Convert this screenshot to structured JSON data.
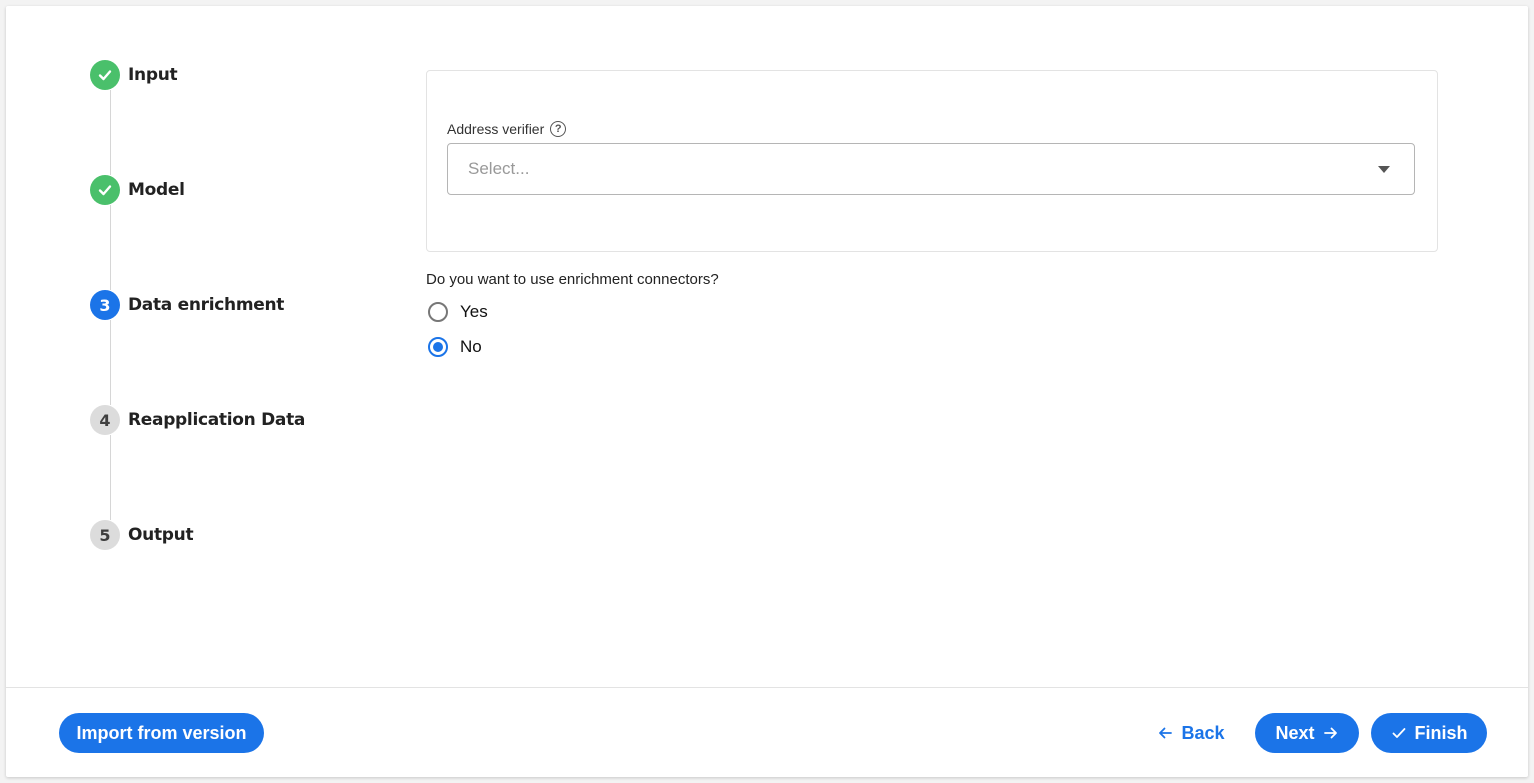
{
  "stepper": {
    "steps": [
      {
        "label": "Input",
        "status": "done",
        "number": "1"
      },
      {
        "label": "Model",
        "status": "done",
        "number": "2"
      },
      {
        "label": "Data enrichment",
        "status": "active",
        "number": "3"
      },
      {
        "label": "Reapplication Data",
        "status": "pending",
        "number": "4"
      },
      {
        "label": "Output",
        "status": "pending",
        "number": "5"
      }
    ]
  },
  "address": {
    "label": "Address verifier",
    "help_icon": "question-circle-icon",
    "placeholder": "Select..."
  },
  "enrichment": {
    "question": "Do you want to use enrichment connectors?",
    "options": [
      {
        "label": "Yes",
        "checked": false
      },
      {
        "label": "No",
        "checked": true
      }
    ]
  },
  "footer": {
    "import_label": "Import from version",
    "back_label": "Back",
    "next_label": "Next",
    "finish_label": "Finish"
  },
  "colors": {
    "primary": "#1b74e8",
    "done": "#4ac06b",
    "pending": "#dcdcdc"
  }
}
